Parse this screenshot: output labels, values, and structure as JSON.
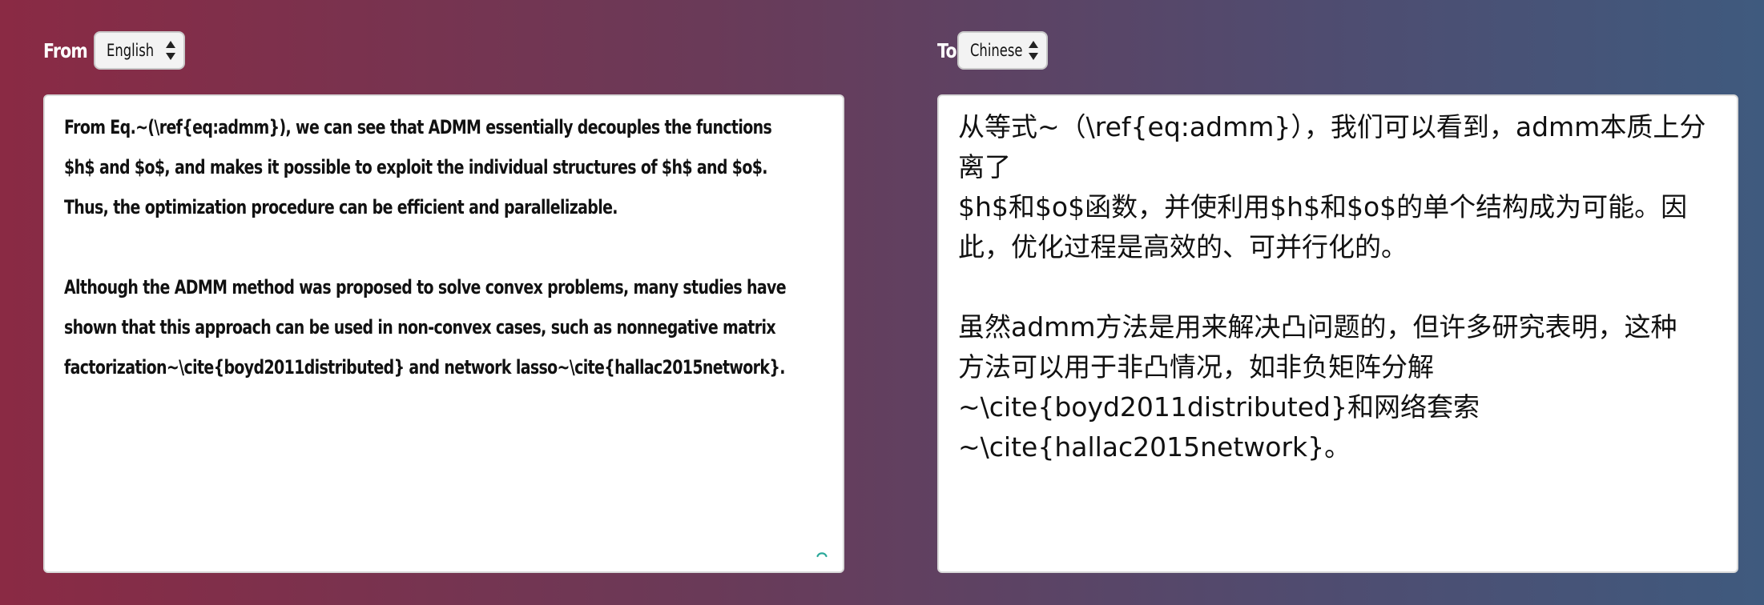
{
  "source": {
    "label": "From",
    "language": "English",
    "paragraphs": [
      "From Eq.~(\\ref{eq:admm}), we can see that ADMM essentially decouples the functions\n$h$ and $o$, and makes it possible to exploit the individual structures of $h$ and $o$.\nThus, the optimization procedure can be efficient and parallelizable.",
      "Although the ADMM method was proposed to solve convex problems, many studies have\nshown that this approach can be used in non-convex cases, such as nonnegative matrix\nfactorization~\\cite{boyd2011distributed} and network lasso~\\cite{hallac2015network}."
    ]
  },
  "target": {
    "label": "To",
    "language": "Chinese",
    "paragraphs": [
      "从等式~（\\ref{eq:admm}），我们可以看到，admm本质上分离了\n$h$和$o$函数，并使利用$h$和$o$的单个结构成为可能。因\n此，优化过程是高效的、可并行化的。",
      "虽然admm方法是用来解决凸问题的，但许多研究表明，这种\n方法可以用于非凸情况，如非负矩阵分解\n~\\cite{boyd2011distributed}和网络套索~\\cite{hallac2015network}。"
    ]
  },
  "colors": {
    "background_left": "#8a2a44",
    "background_right": "#3f5a7e",
    "spinner": "#2aa89a"
  },
  "icons": {
    "select_arrows": "updown-arrows-icon",
    "loading": "spinner-icon"
  }
}
